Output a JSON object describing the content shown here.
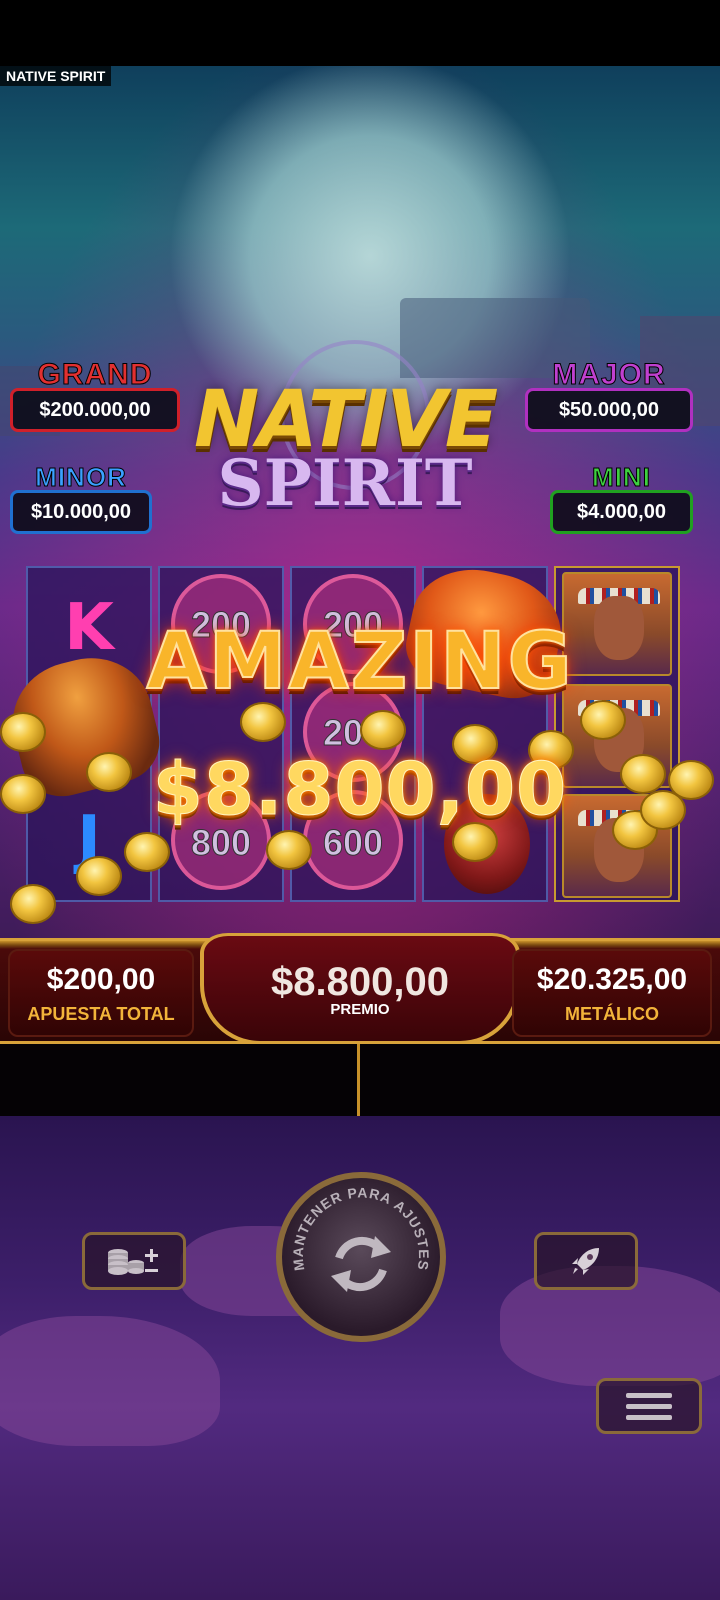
{
  "game": {
    "tab_title": "NATIVE SPIRIT",
    "logo_line1": "NATIVE",
    "logo_line2": "SPIRIT"
  },
  "jackpots": {
    "grand": {
      "label": "GRAND",
      "value": "$200.000,00",
      "color": "#e23030"
    },
    "major": {
      "label": "MAJOR",
      "value": "$50.000,00",
      "color": "#c040d0"
    },
    "minor": {
      "label": "MINOR",
      "value": "$10.000,00",
      "color": "#3aa0ff"
    },
    "mini": {
      "label": "MINI",
      "value": "$4.000,00",
      "color": "#3ed040"
    }
  },
  "reels": {
    "reel1": [
      "K",
      "J"
    ],
    "reel2": [
      "200",
      "",
      "800"
    ],
    "reel3": [
      "200",
      "200",
      "600"
    ],
    "reel4": [
      "drum",
      "",
      "eagle"
    ],
    "reel5": [
      "chief",
      "chief",
      "chief"
    ]
  },
  "win": {
    "title": "AMAZING",
    "amount": "$8.800,00"
  },
  "hud": {
    "bet_value": "$200,00",
    "bet_label": "APUESTA TOTAL",
    "prize_value": "$8.800,00",
    "prize_label": "PREMIO",
    "balance_value": "$20.325,00",
    "balance_label": "METÁLICO"
  },
  "controls": {
    "spin_text": "MANTENER PARA AJUSTES",
    "bet_icon": "coins-plus-minus-icon",
    "turbo_icon": "rocket-icon",
    "menu_icon": "hamburger-menu-icon"
  },
  "colors": {
    "accent_gold": "#d8a23a",
    "hud_red": "#4a0a0a"
  }
}
